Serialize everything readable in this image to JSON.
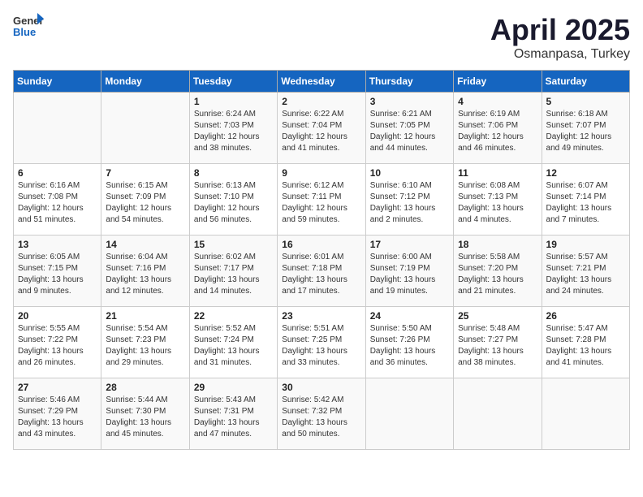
{
  "header": {
    "logo_general": "General",
    "logo_blue": "Blue",
    "title": "April 2025",
    "location": "Osmanpasa, Turkey"
  },
  "weekdays": [
    "Sunday",
    "Monday",
    "Tuesday",
    "Wednesday",
    "Thursday",
    "Friday",
    "Saturday"
  ],
  "weeks": [
    [
      {
        "day": "",
        "info": ""
      },
      {
        "day": "",
        "info": ""
      },
      {
        "day": "1",
        "info": "Sunrise: 6:24 AM\nSunset: 7:03 PM\nDaylight: 12 hours and 38 minutes."
      },
      {
        "day": "2",
        "info": "Sunrise: 6:22 AM\nSunset: 7:04 PM\nDaylight: 12 hours and 41 minutes."
      },
      {
        "day": "3",
        "info": "Sunrise: 6:21 AM\nSunset: 7:05 PM\nDaylight: 12 hours and 44 minutes."
      },
      {
        "day": "4",
        "info": "Sunrise: 6:19 AM\nSunset: 7:06 PM\nDaylight: 12 hours and 46 minutes."
      },
      {
        "day": "5",
        "info": "Sunrise: 6:18 AM\nSunset: 7:07 PM\nDaylight: 12 hours and 49 minutes."
      }
    ],
    [
      {
        "day": "6",
        "info": "Sunrise: 6:16 AM\nSunset: 7:08 PM\nDaylight: 12 hours and 51 minutes."
      },
      {
        "day": "7",
        "info": "Sunrise: 6:15 AM\nSunset: 7:09 PM\nDaylight: 12 hours and 54 minutes."
      },
      {
        "day": "8",
        "info": "Sunrise: 6:13 AM\nSunset: 7:10 PM\nDaylight: 12 hours and 56 minutes."
      },
      {
        "day": "9",
        "info": "Sunrise: 6:12 AM\nSunset: 7:11 PM\nDaylight: 12 hours and 59 minutes."
      },
      {
        "day": "10",
        "info": "Sunrise: 6:10 AM\nSunset: 7:12 PM\nDaylight: 13 hours and 2 minutes."
      },
      {
        "day": "11",
        "info": "Sunrise: 6:08 AM\nSunset: 7:13 PM\nDaylight: 13 hours and 4 minutes."
      },
      {
        "day": "12",
        "info": "Sunrise: 6:07 AM\nSunset: 7:14 PM\nDaylight: 13 hours and 7 minutes."
      }
    ],
    [
      {
        "day": "13",
        "info": "Sunrise: 6:05 AM\nSunset: 7:15 PM\nDaylight: 13 hours and 9 minutes."
      },
      {
        "day": "14",
        "info": "Sunrise: 6:04 AM\nSunset: 7:16 PM\nDaylight: 13 hours and 12 minutes."
      },
      {
        "day": "15",
        "info": "Sunrise: 6:02 AM\nSunset: 7:17 PM\nDaylight: 13 hours and 14 minutes."
      },
      {
        "day": "16",
        "info": "Sunrise: 6:01 AM\nSunset: 7:18 PM\nDaylight: 13 hours and 17 minutes."
      },
      {
        "day": "17",
        "info": "Sunrise: 6:00 AM\nSunset: 7:19 PM\nDaylight: 13 hours and 19 minutes."
      },
      {
        "day": "18",
        "info": "Sunrise: 5:58 AM\nSunset: 7:20 PM\nDaylight: 13 hours and 21 minutes."
      },
      {
        "day": "19",
        "info": "Sunrise: 5:57 AM\nSunset: 7:21 PM\nDaylight: 13 hours and 24 minutes."
      }
    ],
    [
      {
        "day": "20",
        "info": "Sunrise: 5:55 AM\nSunset: 7:22 PM\nDaylight: 13 hours and 26 minutes."
      },
      {
        "day": "21",
        "info": "Sunrise: 5:54 AM\nSunset: 7:23 PM\nDaylight: 13 hours and 29 minutes."
      },
      {
        "day": "22",
        "info": "Sunrise: 5:52 AM\nSunset: 7:24 PM\nDaylight: 13 hours and 31 minutes."
      },
      {
        "day": "23",
        "info": "Sunrise: 5:51 AM\nSunset: 7:25 PM\nDaylight: 13 hours and 33 minutes."
      },
      {
        "day": "24",
        "info": "Sunrise: 5:50 AM\nSunset: 7:26 PM\nDaylight: 13 hours and 36 minutes."
      },
      {
        "day": "25",
        "info": "Sunrise: 5:48 AM\nSunset: 7:27 PM\nDaylight: 13 hours and 38 minutes."
      },
      {
        "day": "26",
        "info": "Sunrise: 5:47 AM\nSunset: 7:28 PM\nDaylight: 13 hours and 41 minutes."
      }
    ],
    [
      {
        "day": "27",
        "info": "Sunrise: 5:46 AM\nSunset: 7:29 PM\nDaylight: 13 hours and 43 minutes."
      },
      {
        "day": "28",
        "info": "Sunrise: 5:44 AM\nSunset: 7:30 PM\nDaylight: 13 hours and 45 minutes."
      },
      {
        "day": "29",
        "info": "Sunrise: 5:43 AM\nSunset: 7:31 PM\nDaylight: 13 hours and 47 minutes."
      },
      {
        "day": "30",
        "info": "Sunrise: 5:42 AM\nSunset: 7:32 PM\nDaylight: 13 hours and 50 minutes."
      },
      {
        "day": "",
        "info": ""
      },
      {
        "day": "",
        "info": ""
      },
      {
        "day": "",
        "info": ""
      }
    ]
  ]
}
